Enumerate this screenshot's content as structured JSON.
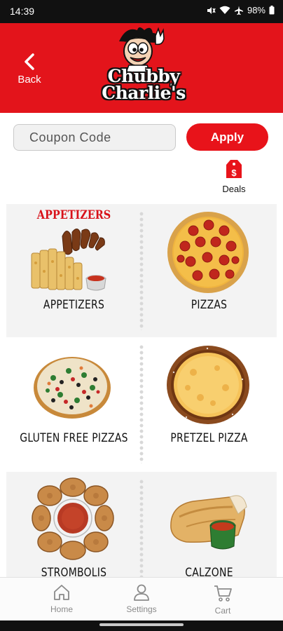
{
  "status_bar": {
    "time": "14:39",
    "battery": "98%"
  },
  "header": {
    "back_label": "Back",
    "logo_line1": "Chubby",
    "logo_line2": "Charlie's"
  },
  "coupon": {
    "placeholder": "Coupon Code",
    "apply_label": "Apply"
  },
  "deals": {
    "label": "Deals",
    "icon": "price-tag-icon"
  },
  "categories": [
    {
      "label": "APPETIZERS",
      "banner": "APPETIZERS"
    },
    {
      "label": "PIZZAS"
    },
    {
      "label": "GLUTEN FREE PIZZAS"
    },
    {
      "label": "PRETZEL PIZZA"
    },
    {
      "label": "STROMBOLIS"
    },
    {
      "label": "CALZONE"
    }
  ],
  "bottom_nav": [
    {
      "label": "Home",
      "icon": "home-icon"
    },
    {
      "label": "Settings",
      "icon": "person-icon"
    },
    {
      "label": "Cart",
      "icon": "cart-icon"
    }
  ],
  "colors": {
    "brand_red": "#e3141b",
    "apply_red": "#e8131a",
    "nav_grey": "#8a8a8a"
  }
}
